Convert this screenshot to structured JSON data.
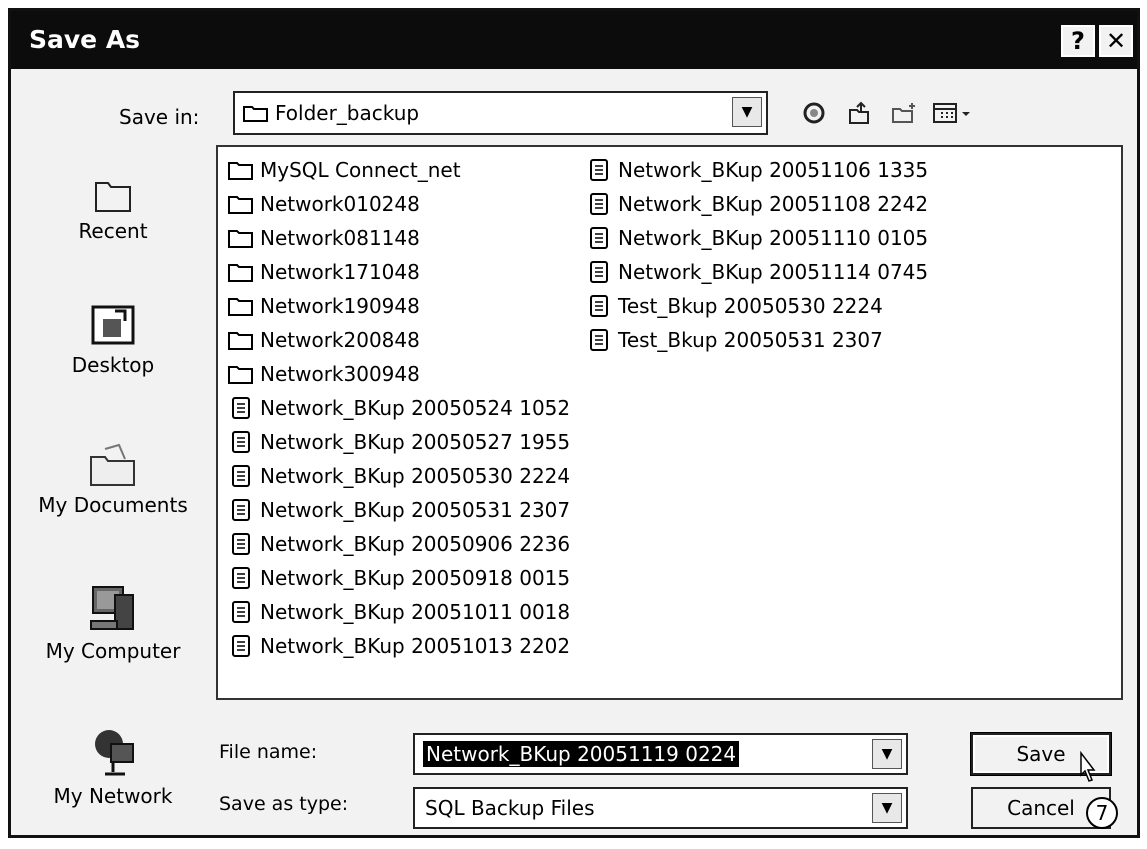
{
  "dialog": {
    "title": "Save As",
    "help_label": "?",
    "close_label": "✕"
  },
  "save_in": {
    "label": "Save in:",
    "value": "Folder_backup"
  },
  "places": [
    {
      "label": "Recent",
      "icon": "recent-icon"
    },
    {
      "label": "Desktop",
      "icon": "desktop-icon"
    },
    {
      "label": "My Documents",
      "icon": "my-documents-icon"
    },
    {
      "label": "My Computer",
      "icon": "my-computer-icon"
    },
    {
      "label": "My Network",
      "icon": "my-network-icon"
    }
  ],
  "files": {
    "column1": [
      {
        "name": "MySQL Connect_net",
        "kind": "folder"
      },
      {
        "name": "Network010248",
        "kind": "folder"
      },
      {
        "name": "Network081148",
        "kind": "folder"
      },
      {
        "name": "Network171048",
        "kind": "folder"
      },
      {
        "name": "Network190948",
        "kind": "folder"
      },
      {
        "name": "Network200848",
        "kind": "folder"
      },
      {
        "name": "Network300948",
        "kind": "folder"
      },
      {
        "name": "Network_BKup 20050524 1052",
        "kind": "file"
      },
      {
        "name": "Network_BKup 20050527 1955",
        "kind": "file"
      },
      {
        "name": "Network_BKup 20050530 2224",
        "kind": "file"
      },
      {
        "name": "Network_BKup 20050531 2307",
        "kind": "file"
      },
      {
        "name": "Network_BKup 20050906 2236",
        "kind": "file"
      },
      {
        "name": "Network_BKup 20050918 0015",
        "kind": "file"
      },
      {
        "name": "Network_BKup 20051011 0018",
        "kind": "file"
      },
      {
        "name": "Network_BKup 20051013 2202",
        "kind": "file"
      }
    ],
    "column2": [
      {
        "name": "Network_BKup 20051106 1335",
        "kind": "file"
      },
      {
        "name": "Network_BKup 20051108 2242",
        "kind": "file"
      },
      {
        "name": "Network_BKup 20051110 0105",
        "kind": "file"
      },
      {
        "name": "Network_BKup 20051114 0745",
        "kind": "file"
      },
      {
        "name": "Test_Bkup 20050530 2224",
        "kind": "file"
      },
      {
        "name": "Test_Bkup 20050531 2307",
        "kind": "file"
      }
    ]
  },
  "file_name": {
    "label": "File name:",
    "value": "Network_BKup 20051119 0224"
  },
  "save_as_type": {
    "label": "Save as type:",
    "value": "SQL Backup Files"
  },
  "buttons": {
    "save": "Save",
    "cancel": "Cancel"
  },
  "step_badge": "7"
}
